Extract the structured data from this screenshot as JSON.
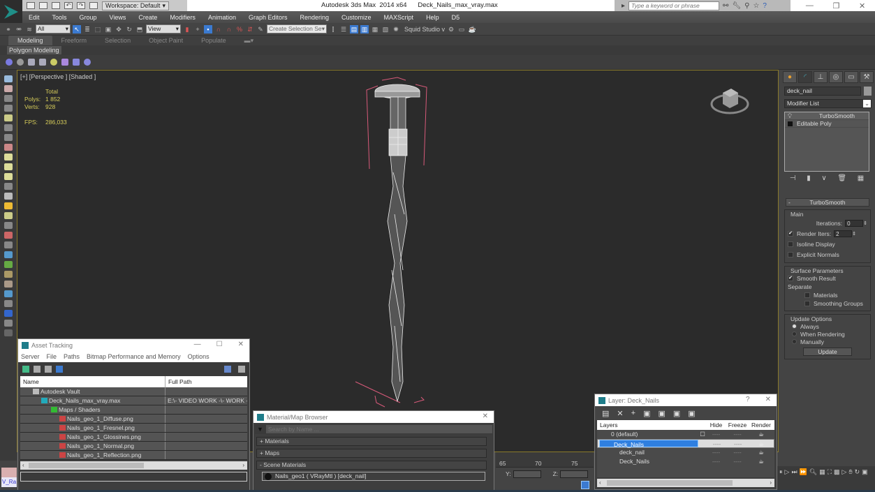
{
  "app": {
    "title": "Autodesk 3ds Max  2014 x64",
    "file": "Deck_Nails_max_vray.max",
    "workspace": "Workspace: Default",
    "search_placeholder": "Type a keyword or phrase"
  },
  "menu": [
    "Edit",
    "Tools",
    "Group",
    "Views",
    "Create",
    "Modifiers",
    "Animation",
    "Graph Editors",
    "Rendering",
    "Customize",
    "MAXScript",
    "Help",
    "D5"
  ],
  "toolbar": {
    "selection_filter": "All",
    "reference_coord": "View",
    "named_selection": "Create Selection Se",
    "plugin_label": "Squid Studio v"
  },
  "ribbon": {
    "tabs": [
      "Modeling",
      "Freeform",
      "Selection",
      "Object Paint",
      "Populate"
    ],
    "active_tab": "Modeling",
    "panel": "Polygon Modeling"
  },
  "viewport": {
    "label": "[+] [Perspective ] [Shaded ]",
    "stats": {
      "header": "Total",
      "polys_label": "Polys:",
      "polys": "1 852",
      "verts_label": "Verts:",
      "verts": "928",
      "fps_label": "FPS:",
      "fps": "286,033"
    }
  },
  "command_panel": {
    "object_name": "deck_nail",
    "modifier_list": "Modifier List",
    "stack": [
      "TurboSmooth",
      "Editable Poly"
    ],
    "rollout": "TurboSmooth",
    "main_group": "Main",
    "iterations_label": "Iterations:",
    "iterations": "0",
    "render_iters_label": "Render Iters:",
    "render_iters": "2",
    "render_iters_checked": true,
    "isoline_label": "Isoline Display",
    "explicit_normals_label": "Explicit Normals",
    "surface_group": "Surface Parameters",
    "smooth_result_label": "Smooth Result",
    "separate_label": "Separate",
    "materials_label": "Materials",
    "smoothing_groups_label": "Smoothing Groups",
    "update_group": "Update Options",
    "update_options": [
      "Always",
      "When Rendering",
      "Manually"
    ],
    "update_selected": "Always",
    "update_button": "Update"
  },
  "asset_tracking": {
    "title": "Asset Tracking",
    "menu": [
      "Server",
      "File",
      "Paths",
      "Bitmap Performance and Memory",
      "Options"
    ],
    "columns": [
      "Name",
      "Full Path"
    ],
    "rows": [
      {
        "name": "Autodesk Vault",
        "path": "",
        "indent": 1,
        "icon": "vault-icon"
      },
      {
        "name": "Deck_Nails_max_vray.max",
        "path": "E:\\- VIDEO WORK -\\- WORK -",
        "indent": 2,
        "icon": "max-file-icon"
      },
      {
        "name": "Maps / Shaders",
        "path": "",
        "indent": 3,
        "icon": "maps-folder-icon"
      },
      {
        "name": "Nails_geo_1_Diffuse.png",
        "path": "",
        "indent": 4,
        "icon": "png-file-icon"
      },
      {
        "name": "Nails_geo_1_Fresnel.png",
        "path": "",
        "indent": 4,
        "icon": "png-file-icon"
      },
      {
        "name": "Nails_geo_1_Glossines.png",
        "path": "",
        "indent": 4,
        "icon": "png-file-icon"
      },
      {
        "name": "Nails_geo_1_Normal.png",
        "path": "",
        "indent": 4,
        "icon": "png-file-icon"
      },
      {
        "name": "Nails_geo_1_Reflection.png",
        "path": "",
        "indent": 4,
        "icon": "png-file-icon"
      }
    ]
  },
  "material_browser": {
    "title": "Material/Map Browser",
    "search_placeholder": "Search by Name ...",
    "categories": [
      "+ Materials",
      "+ Maps",
      "- Scene Materials"
    ],
    "scene_material": "Nails_geo1  ( VRayMtl )  [deck_nail]"
  },
  "timeline": {
    "ticks": [
      "65",
      "70",
      "75"
    ],
    "y_label": "Y:",
    "z_label": "Z:"
  },
  "layer_dialog": {
    "title": "Layer: Deck_Nails",
    "help": "?",
    "columns": [
      "Layers",
      "",
      "Hide",
      "Freeze",
      "Render"
    ],
    "rows": [
      {
        "name": "0 (default)",
        "indent": 1,
        "current": "☐",
        "selected": false
      },
      {
        "name": "Deck_Nails",
        "indent": 1,
        "current": "✓",
        "selected": true
      },
      {
        "name": "deck_nail",
        "indent": 2,
        "current": "",
        "selected": false
      },
      {
        "name": "Deck_Nails",
        "indent": 2,
        "current": "",
        "selected": false
      }
    ],
    "hide": "----",
    "freeze": "----"
  },
  "status": {
    "maxscript_mini": "V_Ra"
  }
}
